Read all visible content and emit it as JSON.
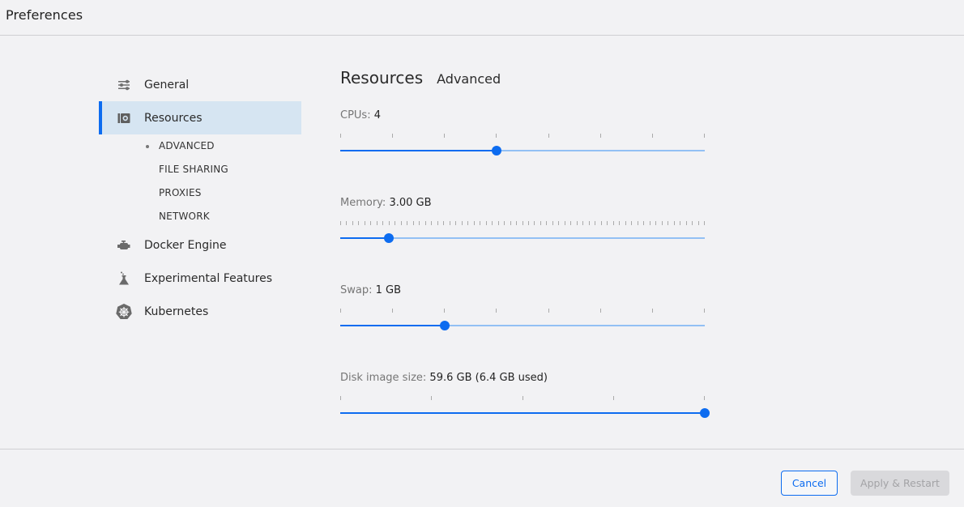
{
  "window": {
    "title": "Preferences"
  },
  "sidebar": {
    "items": [
      {
        "label": "General",
        "icon": "sliders-icon",
        "active": false
      },
      {
        "label": "Resources",
        "icon": "hard-drive-icon",
        "active": true
      },
      {
        "label": "Docker Engine",
        "icon": "engine-icon",
        "active": false
      },
      {
        "label": "Experimental Features",
        "icon": "flask-icon",
        "active": false
      },
      {
        "label": "Kubernetes",
        "icon": "kubernetes-icon",
        "active": false
      }
    ],
    "subitems": [
      {
        "label": "ADVANCED",
        "active": true
      },
      {
        "label": "FILE SHARING",
        "active": false
      },
      {
        "label": "PROXIES",
        "active": false
      },
      {
        "label": "NETWORK",
        "active": false
      }
    ]
  },
  "main": {
    "title": "Resources",
    "subtitle": "Advanced",
    "settings": [
      {
        "key": "CPUs:",
        "value": "4",
        "min": 1,
        "max": 8,
        "current": 4,
        "ticks": 8
      },
      {
        "key": "Memory:",
        "value": "3.00 GB",
        "min": 1,
        "max": 16,
        "current": 3,
        "ticks": 61
      },
      {
        "key": "Swap:",
        "value": "1 GB",
        "min": 0,
        "max": 3.5,
        "current": 1,
        "ticks": 8
      },
      {
        "key": "Disk image size:",
        "value": "59.6 GB (6.4 GB used)",
        "min": 0,
        "max": 1,
        "current": 1,
        "ticks": 5
      }
    ]
  },
  "footer": {
    "cancel_label": "Cancel",
    "apply_label": "Apply & Restart",
    "apply_enabled": false
  },
  "colors": {
    "accent": "#0d6cf0",
    "track_light": "#93c0f4",
    "active_bg": "#d6e5f2",
    "background": "#f2f2f4"
  }
}
